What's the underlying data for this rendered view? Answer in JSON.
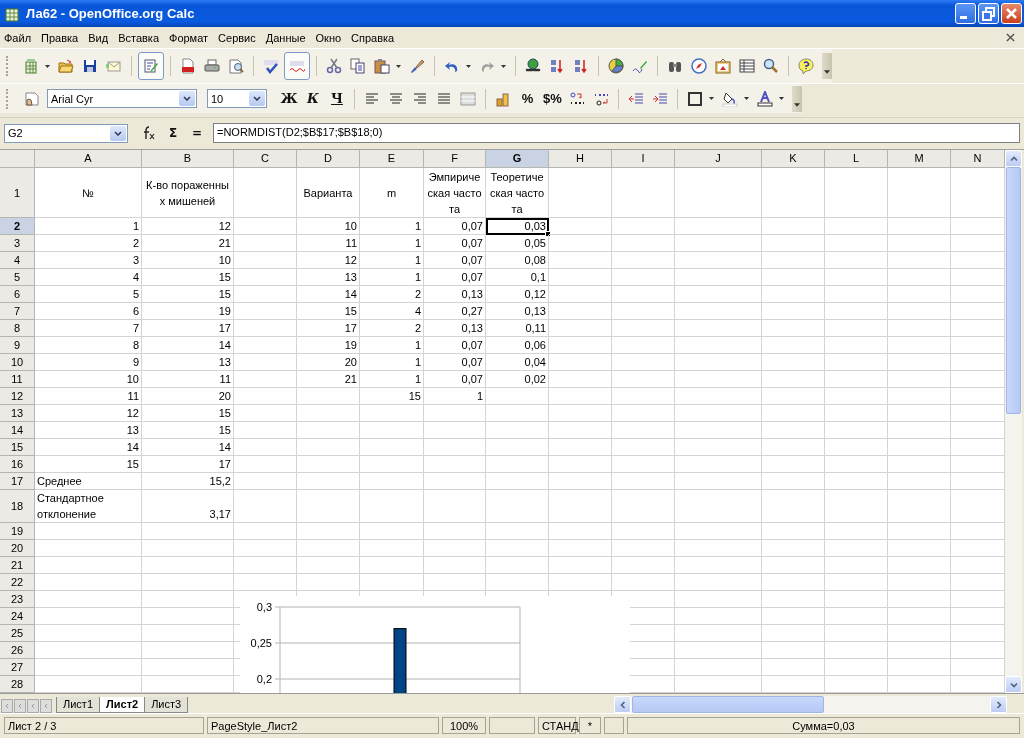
{
  "window": {
    "title": "Ла62 - OpenOffice.org Calc"
  },
  "menu": [
    "Файл",
    "Правка",
    "Вид",
    "Вставка",
    "Формат",
    "Сервис",
    "Данные",
    "Окно",
    "Справка"
  ],
  "toolbar": {
    "edit_file_on": true,
    "auto_spellcheck_on": true
  },
  "formatting": {
    "font": "Arial Cyr",
    "size": "10",
    "text_style_buttons": [
      "Ж",
      "К",
      "Ч"
    ],
    "number_buttons": [
      "%",
      "$%"
    ]
  },
  "formula_bar": {
    "cell_ref": "G2",
    "buttons": [
      "Σ",
      "="
    ],
    "formula": "=NORMDIST(D2;$B$17;$B$18;0)"
  },
  "sheet": {
    "columns": [
      {
        "label": "A",
        "selected": false
      },
      {
        "label": "B",
        "selected": false
      },
      {
        "label": "C",
        "selected": false
      },
      {
        "label": "D",
        "selected": false
      },
      {
        "label": "E",
        "selected": false
      },
      {
        "label": "F",
        "selected": false
      },
      {
        "label": "G",
        "selected": true
      },
      {
        "label": "H",
        "selected": false
      },
      {
        "label": "I",
        "selected": false
      },
      {
        "label": "J",
        "selected": false
      },
      {
        "label": "K",
        "selected": false
      },
      {
        "label": "L",
        "selected": false
      },
      {
        "label": "M",
        "selected": false
      },
      {
        "label": "N",
        "selected": false
      }
    ],
    "rows": [
      {
        "num": "1",
        "selected": false,
        "kind": "header",
        "cells": {
          "A": {
            "text": "№"
          },
          "B": {
            "text": "К-во пораженных мишеней"
          },
          "D": {
            "text": "Варианта"
          },
          "E": {
            "text": "m"
          },
          "F": {
            "text": "Эмпирическая частота"
          },
          "G": {
            "text": "Теоретическая частота"
          }
        }
      },
      {
        "num": "2",
        "selected": true,
        "cells": {
          "A": {
            "text": "1"
          },
          "B": {
            "text": "12"
          },
          "D": {
            "text": "10"
          },
          "E": {
            "text": "1"
          },
          "F": {
            "text": "0,07"
          },
          "G": {
            "text": "0,03",
            "active": true
          }
        }
      },
      {
        "num": "3",
        "selected": false,
        "cells": {
          "A": {
            "text": "2"
          },
          "B": {
            "text": "21"
          },
          "D": {
            "text": "11"
          },
          "E": {
            "text": "1"
          },
          "F": {
            "text": "0,07"
          },
          "G": {
            "text": "0,05",
            "active": false
          }
        }
      },
      {
        "num": "4",
        "selected": false,
        "cells": {
          "A": {
            "text": "3"
          },
          "B": {
            "text": "10"
          },
          "D": {
            "text": "12"
          },
          "E": {
            "text": "1"
          },
          "F": {
            "text": "0,07"
          },
          "G": {
            "text": "0,08",
            "active": false
          }
        }
      },
      {
        "num": "5",
        "selected": false,
        "cells": {
          "A": {
            "text": "4"
          },
          "B": {
            "text": "15"
          },
          "D": {
            "text": "13"
          },
          "E": {
            "text": "1"
          },
          "F": {
            "text": "0,07"
          },
          "G": {
            "text": "0,1",
            "active": false
          }
        }
      },
      {
        "num": "6",
        "selected": false,
        "cells": {
          "A": {
            "text": "5"
          },
          "B": {
            "text": "15"
          },
          "D": {
            "text": "14"
          },
          "E": {
            "text": "2"
          },
          "F": {
            "text": "0,13"
          },
          "G": {
            "text": "0,12",
            "active": false
          }
        }
      },
      {
        "num": "7",
        "selected": false,
        "cells": {
          "A": {
            "text": "6"
          },
          "B": {
            "text": "19"
          },
          "D": {
            "text": "15"
          },
          "E": {
            "text": "4"
          },
          "F": {
            "text": "0,27"
          },
          "G": {
            "text": "0,13",
            "active": false
          }
        }
      },
      {
        "num": "8",
        "selected": false,
        "cells": {
          "A": {
            "text": "7"
          },
          "B": {
            "text": "17"
          },
          "D": {
            "text": "17"
          },
          "E": {
            "text": "2"
          },
          "F": {
            "text": "0,13"
          },
          "G": {
            "text": "0,11",
            "active": false
          }
        }
      },
      {
        "num": "9",
        "selected": false,
        "cells": {
          "A": {
            "text": "8"
          },
          "B": {
            "text": "14"
          },
          "D": {
            "text": "19"
          },
          "E": {
            "text": "1"
          },
          "F": {
            "text": "0,07"
          },
          "G": {
            "text": "0,06",
            "active": false
          }
        }
      },
      {
        "num": "10",
        "selected": false,
        "cells": {
          "A": {
            "text": "9"
          },
          "B": {
            "text": "13"
          },
          "D": {
            "text": "20"
          },
          "E": {
            "text": "1"
          },
          "F": {
            "text": "0,07"
          },
          "G": {
            "text": "0,04",
            "active": false
          }
        }
      },
      {
        "num": "11",
        "selected": false,
        "cells": {
          "A": {
            "text": "10"
          },
          "B": {
            "text": "11"
          },
          "D": {
            "text": "21"
          },
          "E": {
            "text": "1"
          },
          "F": {
            "text": "0,07"
          },
          "G": {
            "text": "0,02",
            "active": false
          }
        }
      },
      {
        "num": "12",
        "selected": false,
        "cells": {
          "A": {
            "text": "11"
          },
          "B": {
            "text": "20"
          },
          "E": {
            "text": "15"
          },
          "F": {
            "text": "1"
          }
        }
      },
      {
        "num": "13",
        "selected": false,
        "cells": {
          "A": {
            "text": "12"
          },
          "B": {
            "text": "15"
          }
        }
      },
      {
        "num": "14",
        "selected": false,
        "cells": {
          "A": {
            "text": "13"
          },
          "B": {
            "text": "15"
          }
        }
      },
      {
        "num": "15",
        "selected": false,
        "cells": {
          "A": {
            "text": "14"
          },
          "B": {
            "text": "14"
          }
        }
      },
      {
        "num": "16",
        "selected": false,
        "cells": {
          "A": {
            "text": "15"
          },
          "B": {
            "text": "17"
          }
        }
      },
      {
        "num": "17",
        "selected": false,
        "cells": {
          "A": {
            "text": "Среднее",
            "kind": "label"
          },
          "B": {
            "text": "15,2"
          }
        }
      },
      {
        "num": "18",
        "selected": false,
        "cells": {
          "A": {
            "text": "Стандартное отклонение",
            "kind": "label"
          },
          "B": {
            "text": "3,17"
          }
        }
      },
      {
        "num": "19",
        "selected": false
      },
      {
        "num": "20",
        "selected": false
      },
      {
        "num": "21",
        "selected": false
      },
      {
        "num": "22",
        "selected": false
      },
      {
        "num": "23",
        "selected": false
      },
      {
        "num": "24",
        "selected": false
      },
      {
        "num": "25",
        "selected": false
      },
      {
        "num": "26",
        "selected": false
      },
      {
        "num": "27",
        "selected": false
      },
      {
        "num": "28",
        "selected": false
      }
    ],
    "chart_data": {
      "type": "bar",
      "yticks": [
        {
          "value": 0.2,
          "label": "0,2"
        },
        {
          "value": 0.25,
          "label": "0,25"
        },
        {
          "value": 0.3,
          "label": "0,3"
        }
      ],
      "ylim": [
        0.175,
        0.3
      ],
      "series": [
        {
          "color": "#004586",
          "values": [
            0.27
          ]
        }
      ]
    }
  },
  "sheet_tabs": [
    {
      "label": "Лист1",
      "selected": false
    },
    {
      "label": "Лист2",
      "selected": true
    },
    {
      "label": "Лист3",
      "selected": false
    }
  ],
  "status_bar": {
    "sheet": "Лист 2 / 3",
    "page_style": "PageStyle_Лист2",
    "zoom": "100%",
    "mode": "СТАНД",
    "modified": "*",
    "sum": "Сумма=0,03"
  }
}
